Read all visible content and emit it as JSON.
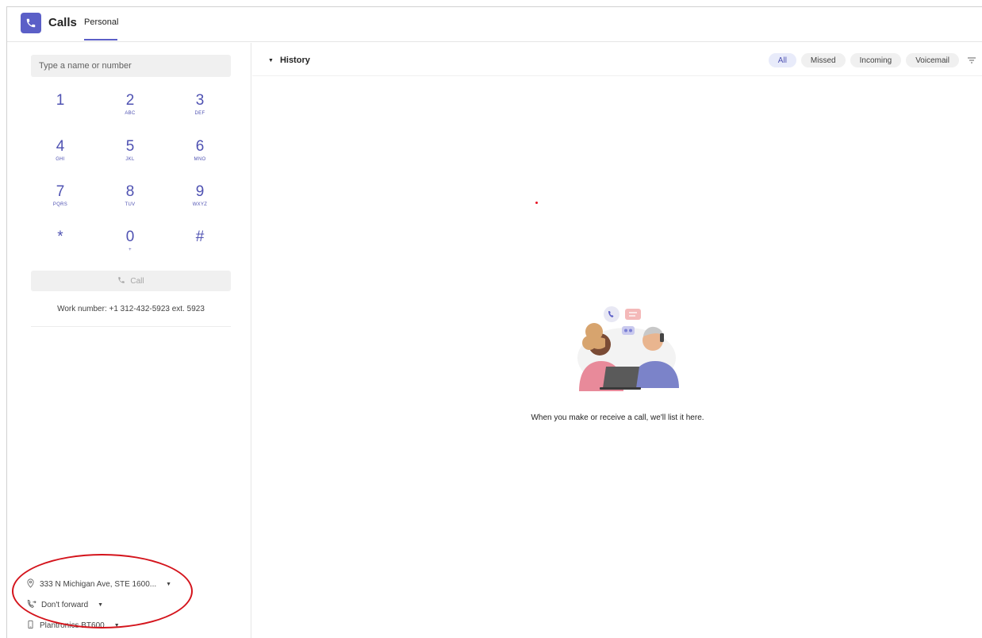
{
  "app": {
    "title": "Calls",
    "tab": "Personal",
    "accent": "#5b5fc7"
  },
  "dialer": {
    "search_placeholder": "Type a name or number",
    "keys": [
      {
        "digit": "1",
        "letters": ""
      },
      {
        "digit": "2",
        "letters": "ABC"
      },
      {
        "digit": "3",
        "letters": "DEF"
      },
      {
        "digit": "4",
        "letters": "GHI"
      },
      {
        "digit": "5",
        "letters": "JKL"
      },
      {
        "digit": "6",
        "letters": "MNO"
      },
      {
        "digit": "7",
        "letters": "PQRS"
      },
      {
        "digit": "8",
        "letters": "TUV"
      },
      {
        "digit": "9",
        "letters": "WXYZ"
      },
      {
        "digit": "*",
        "letters": ""
      },
      {
        "digit": "0",
        "letters": "+"
      },
      {
        "digit": "#",
        "letters": ""
      }
    ],
    "call_label": "Call",
    "work_number": "Work number: +1 312-432-5923 ext. 5923"
  },
  "settings": {
    "location": "333 N Michigan Ave, STE 1600...",
    "forwarding": "Don't forward",
    "device": "Plantronics BT600"
  },
  "history": {
    "title": "History",
    "filters": [
      "All",
      "Missed",
      "Incoming",
      "Voicemail"
    ],
    "active_filter": "All",
    "empty_message": "When you make or receive a call, we'll list it here."
  },
  "colors": {
    "highlight_ring": "#d4141c",
    "chip_active_bg": "#e8ebfa"
  }
}
